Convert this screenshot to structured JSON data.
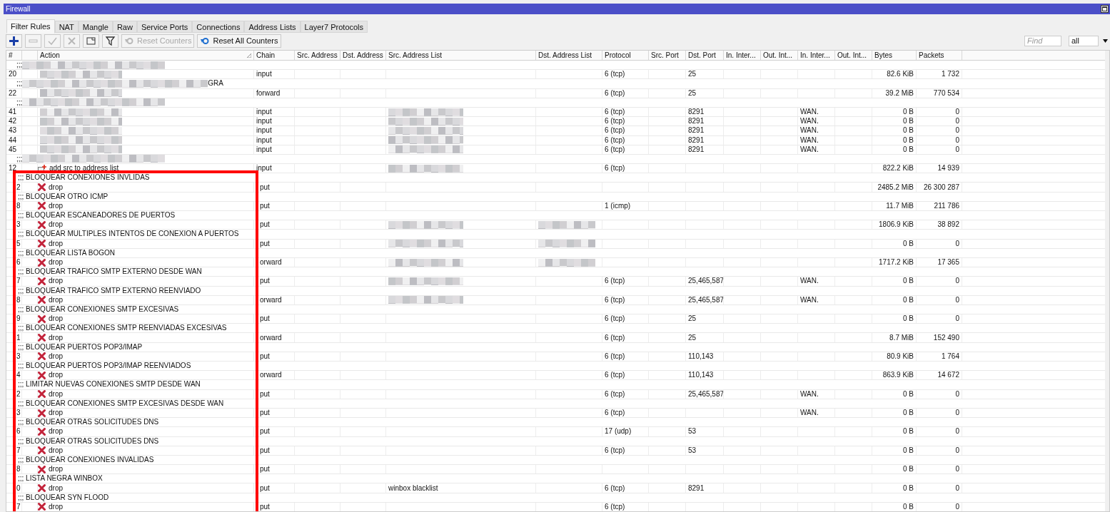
{
  "window": {
    "title": "Firewall"
  },
  "tabs": [
    {
      "label": "Filter Rules",
      "selected": true
    },
    {
      "label": "NAT",
      "selected": false
    },
    {
      "label": "Mangle",
      "selected": false
    },
    {
      "label": "Raw",
      "selected": false
    },
    {
      "label": "Service Ports",
      "selected": false
    },
    {
      "label": "Connections",
      "selected": false
    },
    {
      "label": "Address Lists",
      "selected": false
    },
    {
      "label": "Layer7 Protocols",
      "selected": false
    }
  ],
  "toolbar": [
    {
      "kind": "add",
      "disabled": false
    },
    {
      "kind": "remove",
      "disabled": true
    },
    {
      "kind": "enable",
      "disabled": true
    },
    {
      "kind": "disable",
      "disabled": true
    },
    {
      "kind": "comment",
      "disabled": false
    },
    {
      "kind": "filter",
      "disabled": false
    },
    {
      "kind": "reset",
      "label": "Reset Counters",
      "disabled": true
    },
    {
      "kind": "reset",
      "label": "Reset All Counters",
      "disabled": false
    }
  ],
  "find": {
    "placeholder": "Find"
  },
  "scope_select": {
    "value": "all"
  },
  "table": {
    "columns": [
      "#",
      "Action",
      "Chain",
      "Src. Address",
      "Dst. Address",
      "Src. Address List",
      "Dst. Address List",
      "Protocol",
      "Src. Port",
      "Dst. Port",
      "In. Inter...",
      "Out. Int...",
      "In. Inter...",
      "Out. Int...",
      "Bytes",
      "Packets"
    ],
    "groups": [
      {
        "framed": false,
        "rows": [
          {
            "kind": "comment",
            "text": ";;;",
            "blurred": true
          },
          {
            "kind": "rule",
            "num": "20",
            "action_blurred": true,
            "chain": "input",
            "protocol": "6 (tcp)",
            "dst_port": "25",
            "bytes": "82.6 KiB",
            "packets": "1 732"
          },
          {
            "kind": "comment",
            "text": ";;;",
            "blurred": true,
            "tail": "GRA"
          },
          {
            "kind": "rule",
            "num": "22",
            "action_blurred": true,
            "chain": "forward",
            "protocol": "6 (tcp)",
            "dst_port": "25",
            "bytes": "39.2 MiB",
            "packets": "770 534"
          },
          {
            "kind": "comment",
            "text": ";;;",
            "blurred": true
          },
          {
            "kind": "rule",
            "num": "41",
            "action_blurred": true,
            "src_list_blurred": true,
            "chain": "input",
            "protocol": "6 (tcp)",
            "dst_port": "8291",
            "in_iface_list": "WAN.",
            "bytes": "0 B",
            "packets": "0"
          },
          {
            "kind": "rule",
            "num": "42",
            "action_blurred": true,
            "src_list_blurred": true,
            "chain": "input",
            "protocol": "6 (tcp)",
            "dst_port": "8291",
            "in_iface_list": "WAN.",
            "bytes": "0 B",
            "packets": "0"
          },
          {
            "kind": "rule",
            "num": "43",
            "action_blurred": true,
            "src_list_blurred": true,
            "chain": "input",
            "protocol": "6 (tcp)",
            "dst_port": "8291",
            "in_iface_list": "WAN.",
            "bytes": "0 B",
            "packets": "0"
          },
          {
            "kind": "rule",
            "num": "44",
            "action_blurred": true,
            "src_list_blurred": true,
            "chain": "input",
            "protocol": "6 (tcp)",
            "dst_port": "8291",
            "in_iface_list": "WAN.",
            "bytes": "0 B",
            "packets": "0"
          },
          {
            "kind": "rule",
            "num": "45",
            "action_blurred": true,
            "src_list_blurred": true,
            "chain": "input",
            "protocol": "6 (tcp)",
            "dst_port": "8291",
            "in_iface_list": "WAN.",
            "bytes": "0 B",
            "packets": "0"
          },
          {
            "kind": "comment",
            "text": ";;;",
            "blurred": true
          },
          {
            "kind": "rule",
            "num": "12",
            "action": {
              "kind": "add-src",
              "label": "add src to address list"
            },
            "src_list_blurred": true,
            "chain": "input",
            "protocol": "6 (tcp)",
            "bytes": "822.2 KiB",
            "packets": "14 939"
          }
        ]
      },
      {
        "framed": true,
        "rows": [
          {
            "kind": "comment",
            "text": ";;; BLOQUEAR CONEXIONES INVLIDAS"
          },
          {
            "kind": "rule",
            "num": "2",
            "action": {
              "kind": "drop",
              "label": "drop"
            },
            "chain": "put",
            "bytes": "2485.2 MiB",
            "packets": "26 300 287"
          },
          {
            "kind": "comment",
            "text": ";;; BLOQUEAR OTRO ICMP"
          },
          {
            "kind": "rule",
            "num": "8",
            "action": {
              "kind": "drop",
              "label": "drop"
            },
            "chain": "put",
            "protocol": "1 (icmp)",
            "bytes": "11.7 MiB",
            "packets": "211 786"
          },
          {
            "kind": "comment",
            "text": ";;; BLOQUEAR ESCANEADORES DE PUERTOS"
          },
          {
            "kind": "rule",
            "num": "3",
            "action": {
              "kind": "drop",
              "label": "drop"
            },
            "src_list_blurred": true,
            "dst_list_blurred": true,
            "chain": "put",
            "bytes": "1806.9 KiB",
            "packets": "38 892"
          },
          {
            "kind": "comment",
            "text": ";;; BLOQUEAR MULTIPLES INTENTOS DE CONEXION A PUERTOS"
          },
          {
            "kind": "rule",
            "num": "5",
            "action": {
              "kind": "drop",
              "label": "drop"
            },
            "src_list_blurred": true,
            "dst_list_blurred": true,
            "chain": "put",
            "bytes": "0 B",
            "packets": "0"
          },
          {
            "kind": "comment",
            "text": ";;; BLOQUEAR LISTA BOGON"
          },
          {
            "kind": "rule",
            "num": "6",
            "action": {
              "kind": "drop",
              "label": "drop"
            },
            "src_list_blurred": true,
            "dst_list_blurred": true,
            "chain": "orward",
            "bytes": "1717.2 KiB",
            "packets": "17 365"
          },
          {
            "kind": "comment",
            "text": ";;; BLOQUEAR TRAFICO SMTP EXTERNO DESDE WAN"
          },
          {
            "kind": "rule",
            "num": "7",
            "action": {
              "kind": "drop",
              "label": "drop"
            },
            "src_list_blurred": true,
            "chain": "put",
            "protocol": "6 (tcp)",
            "dst_port": "25,465,587",
            "in_iface_list": "WAN.",
            "bytes": "0 B",
            "packets": "0"
          },
          {
            "kind": "comment",
            "text": ";;; BLOQUEAR TRAFICO SMTP EXTERNO REENVIADO"
          },
          {
            "kind": "rule",
            "num": "8",
            "action": {
              "kind": "drop",
              "label": "drop"
            },
            "src_list_blurred": true,
            "chain": "orward",
            "protocol": "6 (tcp)",
            "dst_port": "25,465,587",
            "in_iface_list": "WAN.",
            "bytes": "0 B",
            "packets": "0"
          },
          {
            "kind": "comment",
            "text": ";;; BLOQUEAR CONEXIONES SMTP EXCESIVAS"
          },
          {
            "kind": "rule",
            "num": "9",
            "action": {
              "kind": "drop",
              "label": "drop"
            },
            "chain": "put",
            "protocol": "6 (tcp)",
            "dst_port": "25",
            "bytes": "0 B",
            "packets": "0"
          },
          {
            "kind": "comment",
            "text": ";;; BLOQUEAR CONEXIONES SMTP REENVIADAS EXCESIVAS"
          },
          {
            "kind": "rule",
            "num": "1",
            "action": {
              "kind": "drop",
              "label": "drop"
            },
            "chain": "orward",
            "protocol": "6 (tcp)",
            "dst_port": "25",
            "bytes": "8.7 MiB",
            "packets": "152 490"
          },
          {
            "kind": "comment",
            "text": ";;; BLOQUEAR PUERTOS POP3/IMAP"
          },
          {
            "kind": "rule",
            "num": "3",
            "action": {
              "kind": "drop",
              "label": "drop"
            },
            "chain": "put",
            "protocol": "6 (tcp)",
            "dst_port": "110,143",
            "bytes": "80.9 KiB",
            "packets": "1 764"
          },
          {
            "kind": "comment",
            "text": ";;; BLOQUEAR PUERTOS POP3/IMAP REENVIADOS"
          },
          {
            "kind": "rule",
            "num": "4",
            "action": {
              "kind": "drop",
              "label": "drop"
            },
            "chain": "orward",
            "protocol": "6 (tcp)",
            "dst_port": "110,143",
            "bytes": "863.9 KiB",
            "packets": "14 672"
          },
          {
            "kind": "comment",
            "text": ";;; LIMITAR NUEVAS CONEXIONES SMTP DESDE WAN"
          },
          {
            "kind": "rule",
            "num": "2",
            "action": {
              "kind": "drop",
              "label": "drop"
            },
            "chain": "put",
            "protocol": "6 (tcp)",
            "dst_port": "25,465,587",
            "in_iface_list": "WAN.",
            "bytes": "0 B",
            "packets": "0"
          },
          {
            "kind": "comment",
            "text": ";;; BLOQUEAR CONEXIONES SMTP EXCESIVAS DESDE WAN"
          },
          {
            "kind": "rule",
            "num": "3",
            "action": {
              "kind": "drop",
              "label": "drop"
            },
            "chain": "put",
            "protocol": "6 (tcp)",
            "in_iface_list": "WAN.",
            "bytes": "0 B",
            "packets": "0"
          },
          {
            "kind": "comment",
            "text": ";;; BLOQUEAR OTRAS SOLICITUDES DNS"
          },
          {
            "kind": "rule",
            "num": "6",
            "action": {
              "kind": "drop",
              "label": "drop"
            },
            "chain": "put",
            "protocol": "17 (udp)",
            "dst_port": "53",
            "bytes": "0 B",
            "packets": "0"
          },
          {
            "kind": "comment",
            "text": ";;; BLOQUEAR OTRAS SOLICITUDES DNS"
          },
          {
            "kind": "rule",
            "num": "7",
            "action": {
              "kind": "drop",
              "label": "drop"
            },
            "chain": "put",
            "protocol": "6 (tcp)",
            "dst_port": "53",
            "bytes": "0 B",
            "packets": "0"
          },
          {
            "kind": "comment",
            "text": ";;; BLOQUEAR CONEXIONES INVALIDAS"
          },
          {
            "kind": "rule",
            "num": "8",
            "action": {
              "kind": "drop",
              "label": "drop"
            },
            "chain": "put",
            "bytes": "0 B",
            "packets": "0"
          },
          {
            "kind": "comment",
            "text": ";;; LISTA NEGRA WINBOX"
          },
          {
            "kind": "rule",
            "num": "0",
            "action": {
              "kind": "drop",
              "label": "drop"
            },
            "chain": "put",
            "src_list": "winbox blacklist",
            "protocol": "6 (tcp)",
            "dst_port": "8291",
            "bytes": "0 B",
            "packets": "0"
          },
          {
            "kind": "comment",
            "text": ";;; BLOQUEAR SYN FLOOD"
          },
          {
            "kind": "rule",
            "num": "7",
            "action": {
              "kind": "drop",
              "label": "drop"
            },
            "chain": "put",
            "protocol": "6 (tcp)",
            "bytes": "0 B",
            "packets": "0"
          }
        ]
      }
    ]
  }
}
